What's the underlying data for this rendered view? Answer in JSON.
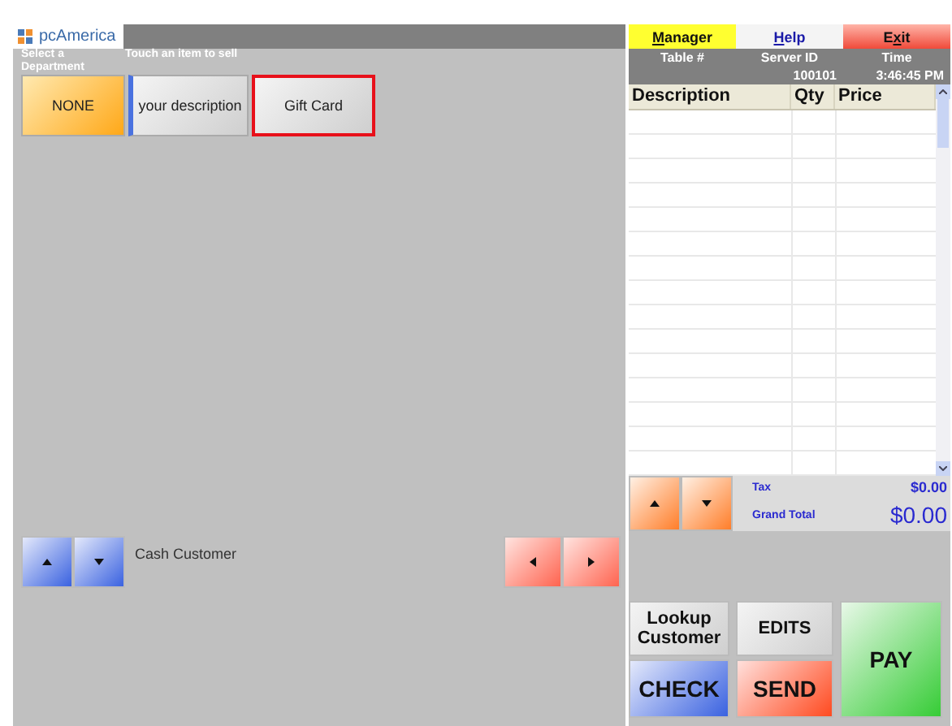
{
  "logo": {
    "text": "pcAmerica"
  },
  "department_label": "Select a Department",
  "items_label": "Touch an item to sell",
  "departments": [
    {
      "label": "NONE",
      "kind": "department",
      "selected": false
    },
    {
      "label": "your description",
      "kind": "item",
      "selected": false
    },
    {
      "label": "Gift Card",
      "kind": "item",
      "selected": true
    }
  ],
  "customer": "Cash Customer",
  "menu": [
    {
      "key": "M",
      "after": "anager",
      "kind": "manager"
    },
    {
      "key": "H",
      "after": "elp",
      "kind": "help"
    },
    {
      "before": "E",
      "key": "x",
      "after": "it",
      "kind": "exit"
    }
  ],
  "info": [
    {
      "header": "Table #"
    },
    {
      "header": "Server ID",
      "value": "100101"
    },
    {
      "header": "Time",
      "value": "3:46:45 PM"
    }
  ],
  "order_table": {
    "columns": [
      "Description",
      "Qty",
      "Price"
    ]
  },
  "totals": [
    {
      "label": "Tax",
      "value": "$0.00",
      "kind": "small"
    },
    {
      "label": "Grand Total",
      "value": "$0.00",
      "kind": "large"
    }
  ],
  "actions": [
    {
      "label": "Lookup Customer",
      "kind": "grey"
    },
    {
      "label": "EDITS",
      "kind": "grey"
    },
    {
      "label": "PAY",
      "kind": "green"
    },
    {
      "label": "CHECK",
      "kind": "blue"
    },
    {
      "label": "SEND",
      "kind": "red"
    }
  ]
}
